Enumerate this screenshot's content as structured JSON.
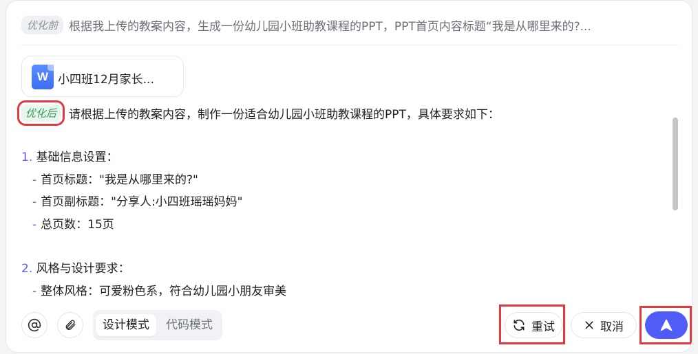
{
  "before": {
    "badge": "优化前",
    "text": "根据我上传的教案内容，生成一份幼儿园小班助教课程的PPT，PPT首页内容标题“我是从哪里来的?..."
  },
  "attachment": {
    "icon_letter": "W",
    "name": "小四班12月家长..."
  },
  "after": {
    "badge": "优化后",
    "text": "请根据上传的教案内容，制作一份适合幼儿园小班助教课程的PPT，具体要求如下："
  },
  "content": {
    "section1": {
      "num": "1.",
      "title": "基础信息设置：",
      "items": [
        "首页标题：\"我是从哪里来的?\"",
        "首页副标题：\"分享人:小四班瑶瑶妈妈\"",
        "总页数：15页"
      ]
    },
    "section2": {
      "num": "2.",
      "title": "风格与设计要求：",
      "items": [
        "整体风格：可爱粉色系，符合幼儿园小朋友审美"
      ]
    },
    "dash": "-"
  },
  "toolbar": {
    "mention_icon": "at-icon",
    "attach_icon": "paperclip-icon",
    "modes": {
      "active": "设计模式",
      "inactive": "代码模式"
    },
    "retry_label": "重试",
    "cancel_label": "取消",
    "send_icon": "arrow-up-icon",
    "accent_color": "#4f5cf5"
  },
  "highlight_color": "#e0393e"
}
